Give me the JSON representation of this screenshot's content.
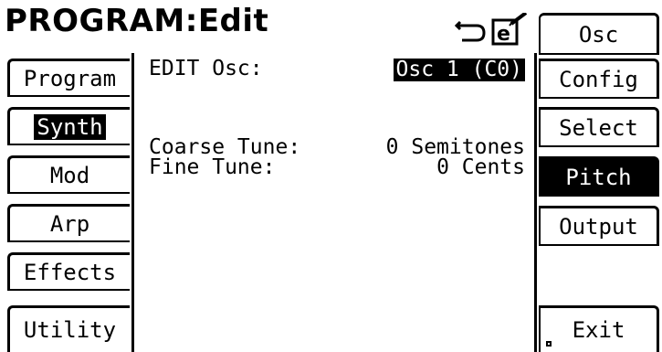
{
  "header": {
    "title": "PROGRAM:Edit",
    "icons": [
      "undo-icon",
      "edit-document-icon"
    ]
  },
  "left_tabs": [
    {
      "label": "Program",
      "active": false
    },
    {
      "label": "Synth",
      "active": true
    },
    {
      "label": "Mod",
      "active": false
    },
    {
      "label": "Arp",
      "active": false
    },
    {
      "label": "Effects",
      "active": false
    },
    {
      "label": "Utility",
      "active": false
    }
  ],
  "right_tabs": {
    "header": "Osc",
    "items": [
      {
        "label": "Config",
        "active": false
      },
      {
        "label": "Select",
        "active": false
      },
      {
        "label": "Pitch",
        "active": true
      },
      {
        "label": "Output",
        "active": false
      }
    ],
    "exit": "Exit"
  },
  "main": {
    "edit_label": "EDIT Osc:",
    "edit_value": "Osc 1 (C0)",
    "params": [
      {
        "label": "Coarse Tune:",
        "value": "0 Semitones"
      },
      {
        "label": "Fine Tune:",
        "value": "0 Cents"
      }
    ]
  }
}
